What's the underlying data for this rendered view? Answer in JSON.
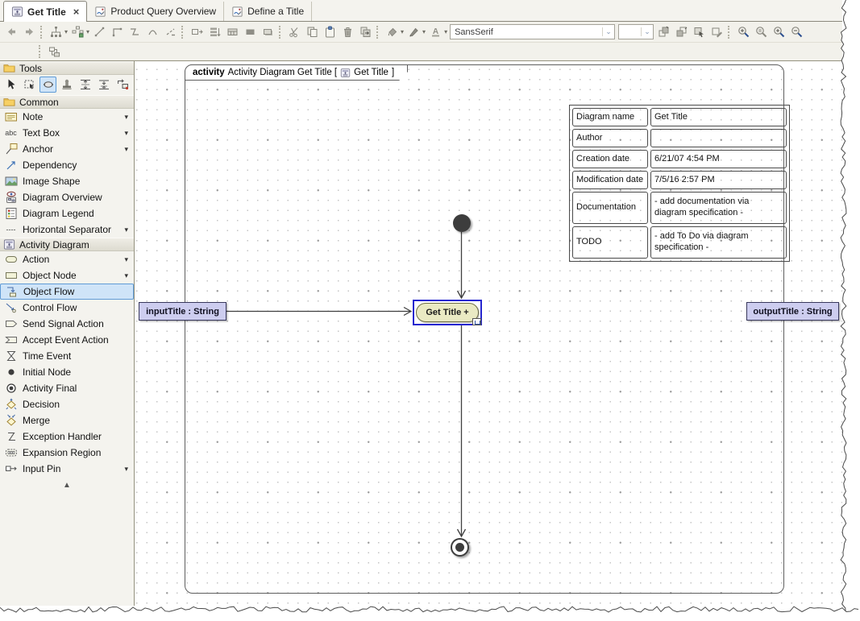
{
  "icons": {
    "dropdown": "▾",
    "scroll_up": "▲"
  },
  "tabs": [
    {
      "label": "Get Title",
      "icon": "activity-diagram-tab-icon",
      "active": true,
      "close": "×"
    },
    {
      "label": "Product Query Overview",
      "icon": "content-diagram-tab-icon",
      "active": false
    },
    {
      "label": "Define a Title",
      "icon": "content-diagram-tab-icon",
      "active": false
    }
  ],
  "toolbar": {
    "font_name": "SansSerif",
    "font_size": "",
    "icon_names": [
      "back",
      "forward",
      "tree-layout",
      "quick-layout",
      "straight-path",
      "rectilinear-path",
      "oblique-path",
      "curved-path",
      "custom-path",
      "autosize-width",
      "autosize-height",
      "grid-rect",
      "filled-rect",
      "shadow-rect",
      "cut",
      "copy",
      "paste",
      "delete",
      "paste-format",
      "fill-color",
      "line-color",
      "font-color",
      "to-front",
      "to-back",
      "select-symbol",
      "format-painter",
      "zoom-selection",
      "zoom-fit",
      "zoom-in",
      "zoom-out",
      "related-elements"
    ]
  },
  "palette": {
    "sections": [
      {
        "title": "Tools"
      },
      {
        "title": "Common"
      },
      {
        "title": "Activity Diagram"
      }
    ],
    "tool_icons": [
      "pointer-tool",
      "marquee-tool",
      "sticky-connector-tool",
      "stamp-tool",
      "vertical-spacing-tool",
      "horizontal-spacing-tool",
      "swap-elements-tool"
    ],
    "common_items": [
      {
        "label": "Note",
        "dropdown": true
      },
      {
        "label": "Text Box",
        "dropdown": true,
        "icon_text": "abc"
      },
      {
        "label": "Anchor",
        "dropdown": true
      },
      {
        "label": "Dependency"
      },
      {
        "label": "Image Shape"
      },
      {
        "label": "Diagram Overview"
      },
      {
        "label": "Diagram Legend"
      },
      {
        "label": "Horizontal Separator",
        "dropdown": true,
        "icon_text": "----"
      }
    ],
    "activity_items": [
      {
        "label": "Action",
        "dropdown": true
      },
      {
        "label": "Object Node",
        "dropdown": true
      },
      {
        "label": "Object Flow",
        "selected": true
      },
      {
        "label": "Control Flow"
      },
      {
        "label": "Send Signal Action"
      },
      {
        "label": "Accept Event Action"
      },
      {
        "label": "Time Event"
      },
      {
        "label": "Initial Node"
      },
      {
        "label": "Activity Final"
      },
      {
        "label": "Decision"
      },
      {
        "label": "Merge"
      },
      {
        "label": "Exception Handler"
      },
      {
        "label": "Expansion Region"
      },
      {
        "label": "Input Pin",
        "dropdown": true
      }
    ]
  },
  "canvas": {
    "frame": {
      "keyword": "activity",
      "title": "Activity Diagram  Get Title [",
      "inner_name": "Get Title",
      "bracket": "]"
    },
    "info_table": {
      "rows": [
        {
          "label": "Diagram name",
          "value": "Get Title"
        },
        {
          "label": "Author",
          "value": ""
        },
        {
          "label": "Creation date",
          "value": "6/21/07 4:54 PM"
        },
        {
          "label": "Modification date",
          "value": "7/5/16 2:57 PM"
        },
        {
          "label": "Documentation",
          "value": "- add documentation via diagram specification -"
        },
        {
          "label": "TODO",
          "value": "- add To Do via diagram specification -"
        }
      ]
    },
    "nodes": {
      "action": {
        "label": "Get Title",
        "decoration": "+"
      },
      "input_param": {
        "label": "inputTitle : String"
      },
      "output_param": {
        "label": "outputTitle : String"
      }
    }
  },
  "colors": {
    "selection_blue": "#2626cf",
    "action_fill": "#eaeac3",
    "param_fill": "#cdcdef",
    "palette_selected_bg": "#cfe4f8",
    "palette_selected_border": "#5f9bd6"
  }
}
